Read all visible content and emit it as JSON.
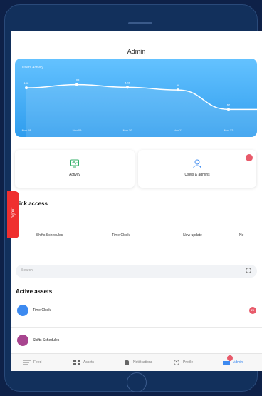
{
  "screen": {
    "title": "Admin"
  },
  "chart_data": {
    "type": "area",
    "title": "Users Activity",
    "categories": [
      "Nov 08",
      "Nov 09",
      "Nov 10",
      "Nov 11",
      "Nov 12"
    ],
    "values": [
      102,
      108,
      103,
      98,
      62
    ],
    "labels": [
      "102",
      "108",
      "103",
      "98",
      "62"
    ],
    "ylim": [
      40,
      130
    ],
    "grid": false
  },
  "cards": [
    {
      "label": "Activity",
      "icon": "monitor-icon"
    },
    {
      "label": "Users & admins",
      "icon": "user-icon",
      "badge": ""
    }
  ],
  "quick_access": {
    "title": "uick access",
    "items": [
      {
        "label": "Shifts Schedules",
        "color": "#e9c8e6",
        "icon": "calendar-icon"
      },
      {
        "label": "Time Clock",
        "color": "#c7dcf8",
        "icon": "clock-icon"
      },
      {
        "label": "New update",
        "color": "#fbe3b0",
        "icon": "message-icon"
      },
      {
        "label": "Ne",
        "color": "#f3c8d8",
        "icon": "partial-icon"
      }
    ]
  },
  "logout": {
    "label": "Logout"
  },
  "search": {
    "placeholder": "Search"
  },
  "active_assets": {
    "title": "Active assets",
    "items": [
      {
        "label": "Time Clock",
        "color": "#3d8af0",
        "icon": "clock-icon",
        "badge": "25"
      },
      {
        "label": "Shifts Schedules",
        "color": "#a8458f",
        "icon": "calendar-icon"
      }
    ]
  },
  "tabbar": [
    {
      "label": "Feed",
      "icon": "feed-icon"
    },
    {
      "label": "Assets",
      "icon": "grid-icon"
    },
    {
      "label": "Notifications",
      "icon": "bell-icon"
    },
    {
      "label": "Profile",
      "icon": "profile-icon"
    },
    {
      "label": "Admin",
      "icon": "admin-icon",
      "badge": ""
    }
  ],
  "colors": {
    "accent": "#2f9dee",
    "danger": "#ef2f2f",
    "frame": "#12305c"
  }
}
